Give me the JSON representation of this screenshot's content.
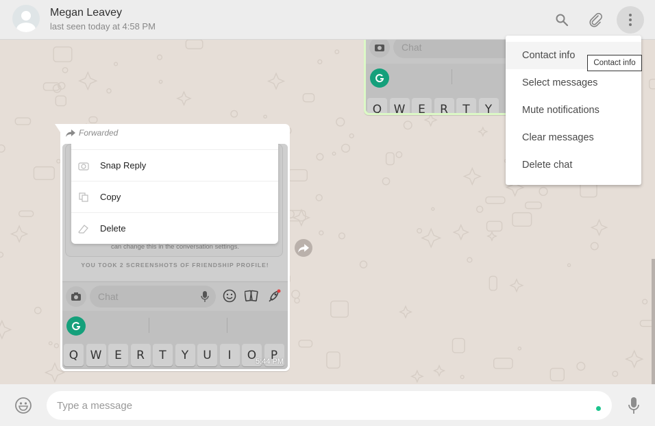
{
  "header": {
    "contact_name": "Megan Leavey",
    "last_seen": "last seen today at 4:58 PM",
    "icons": [
      "search-icon",
      "attach-icon",
      "menu-icon"
    ]
  },
  "dropdown": {
    "items": [
      {
        "label": "Contact info"
      },
      {
        "label": "Select messages"
      },
      {
        "label": "Mute notifications"
      },
      {
        "label": "Clear messages"
      },
      {
        "label": "Delete chat"
      }
    ],
    "tooltip": "Contact info"
  },
  "outgoing_message": {
    "snap_chat_placeholder": "Chat",
    "keys": [
      "Q",
      "W",
      "E",
      "R",
      "T",
      "Y"
    ]
  },
  "incoming_message": {
    "forwarded_label": "Forwarded",
    "context_menu": [
      {
        "label": "Snap Reply",
        "icon": "camera-icon"
      },
      {
        "label": "Copy",
        "icon": "copy-icon"
      },
      {
        "label": "Delete",
        "icon": "eraser-icon"
      }
    ],
    "note": "can change this in the conversation settings.",
    "screenshot_notice": "YOU TOOK 2 SCREENSHOTS OF FRIENDSHIP PROFILE!",
    "snap_chat_placeholder": "Chat",
    "keys": [
      "Q",
      "W",
      "E",
      "R",
      "T",
      "Y",
      "U",
      "I",
      "O",
      "P"
    ],
    "timestamp": "5:44 PM"
  },
  "footer": {
    "input_placeholder": "Type a message",
    "input_value": ""
  },
  "colors": {
    "header_bg": "#ededed",
    "chat_bg": "#e6ded7",
    "outgoing_bubble": "#dcf8c6",
    "incoming_bubble": "#ffffff",
    "grammarly_green": "#15a07b",
    "status_dot": "#1bc48d"
  }
}
